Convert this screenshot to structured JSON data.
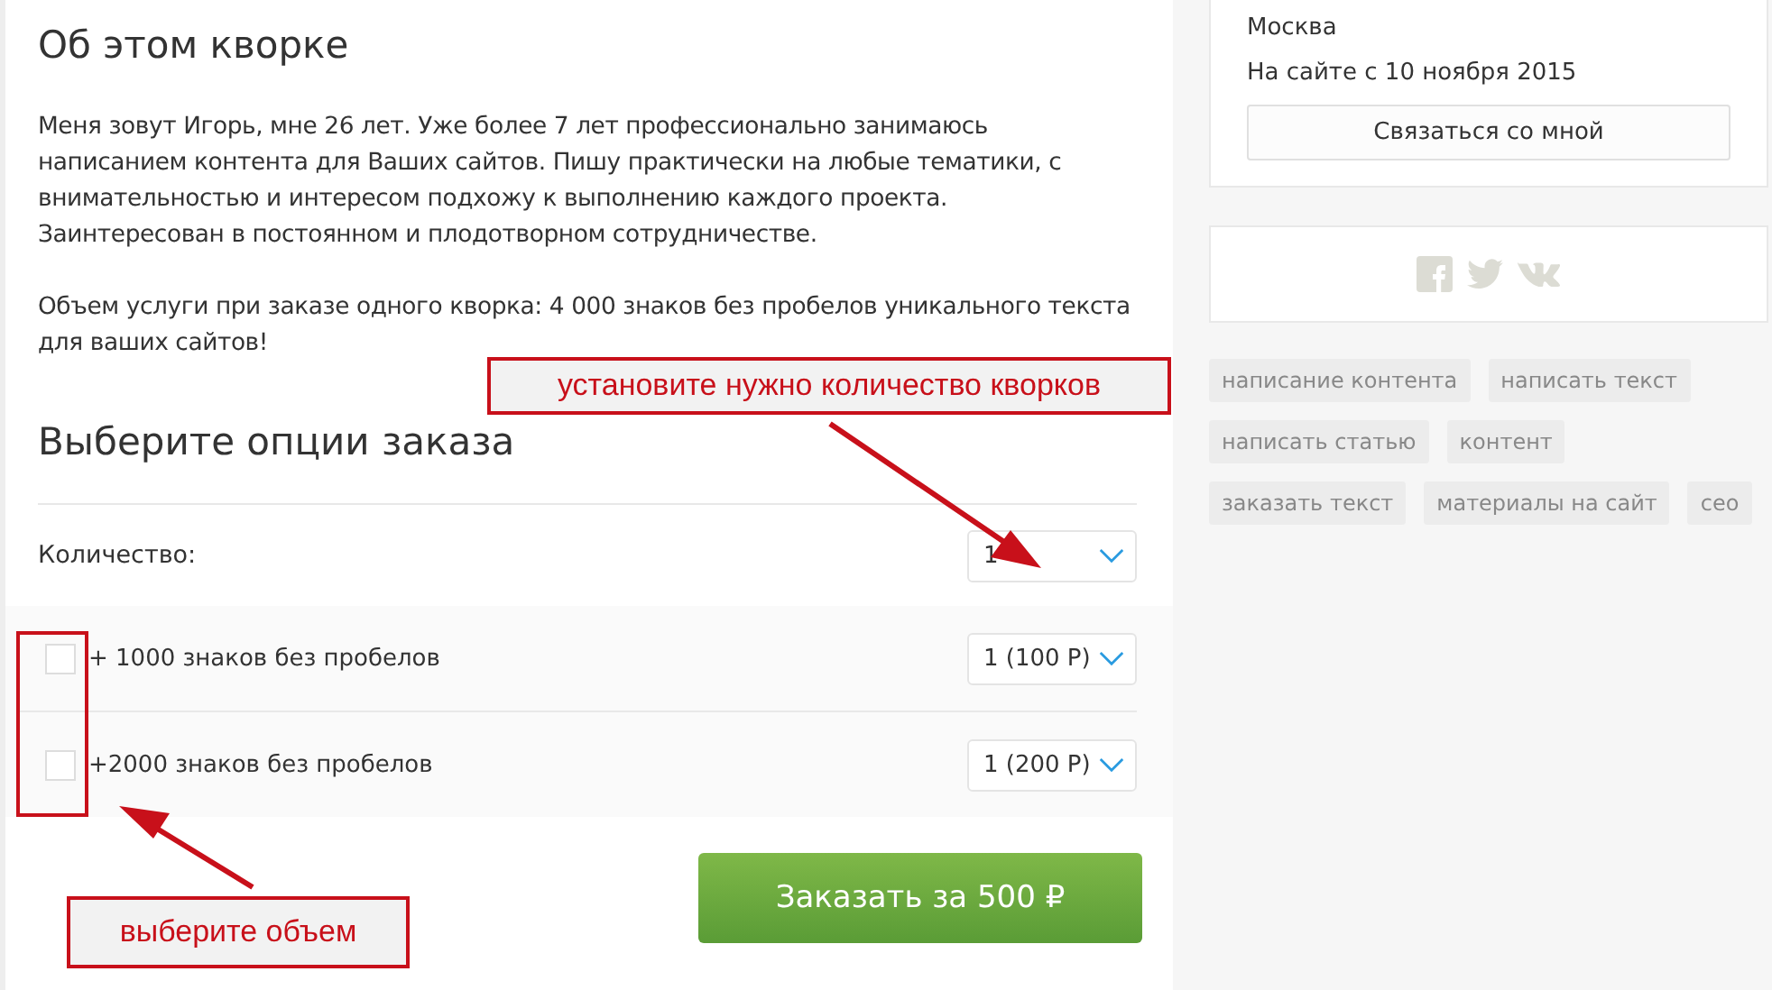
{
  "about": {
    "title": "Об этом кворке",
    "paragraphs": [
      "Меня зовут Игорь, мне 26 лет. Уже более 7 лет профессионально занимаюсь написанием контента для Ваших сайтов. Пишу практически на любые тематики, с внимательностью и интересом подхожу к выполнению каждого проекта. Заинтересован в постоянном и плодотворном сотрудничестве.",
      "Объем услуги при заказе одного кворка: 4 000 знаков без пробелов уникального текста для ваших сайтов!"
    ]
  },
  "options": {
    "title": "Выберите опции заказа",
    "quantity": {
      "label": "Количество:",
      "value": "1"
    },
    "extras": [
      {
        "label": "+ 1000 знаков без пробелов",
        "checked": false,
        "value": "1 (100 Р)"
      },
      {
        "label": "+2000 знаков без пробелов",
        "checked": false,
        "value": "1 (200 Р)"
      }
    ]
  },
  "order_button": "Заказать за 500 ₽",
  "sidebar": {
    "city": "Москва",
    "since": "На сайте с 10 ноября 2015",
    "contact_button": "Связаться со мной",
    "tags": [
      "написание контента",
      "написать текст",
      "написать статью",
      "контент",
      "заказать текст",
      "материалы на сайт",
      "сео"
    ]
  },
  "annotations": [
    {
      "text": "установите нужно количество кворков"
    },
    {
      "text": "выберите объем"
    }
  ]
}
